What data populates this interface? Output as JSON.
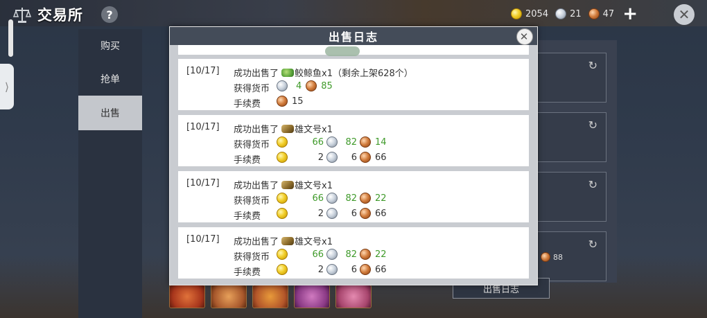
{
  "header": {
    "title": "交易所",
    "help_label": "?",
    "currencies": [
      {
        "type": "gold",
        "value": "2054"
      },
      {
        "type": "silver",
        "value": "21"
      },
      {
        "type": "copper",
        "value": "47"
      }
    ],
    "add_label": "+",
    "close_label": "✕"
  },
  "side_tabs": [
    {
      "label": "购买",
      "active": false
    },
    {
      "label": "抢单",
      "active": false
    },
    {
      "label": "出售",
      "active": true
    }
  ],
  "background_panel": {
    "price_peek": "88",
    "log_button": "出售日志"
  },
  "modal": {
    "title": "出售日志",
    "close_label": "✕",
    "entries": [
      {
        "date": "[10/17]",
        "sold_prefix": "成功出售了",
        "item_icon": "fish-icon",
        "item_text": "鲛鲸鱼x1（剩余上架628个）",
        "earned_label": "获得货币",
        "earned": {
          "silver": "4",
          "copper": "85"
        },
        "fee_label": "手续费",
        "fee": {
          "copper": "15"
        }
      },
      {
        "date": "[10/17]",
        "sold_prefix": "成功出售了",
        "item_icon": "banner-icon",
        "item_text": "雄文号x1",
        "earned_label": "获得货币",
        "earned": {
          "gold": "66",
          "silver": "82",
          "copper": "14"
        },
        "fee_label": "手续费",
        "fee": {
          "gold": "2",
          "silver": "6",
          "copper": "66"
        }
      },
      {
        "date": "[10/17]",
        "sold_prefix": "成功出售了",
        "item_icon": "banner-icon",
        "item_text": "雄文号x1",
        "earned_label": "获得货币",
        "earned": {
          "gold": "66",
          "silver": "82",
          "copper": "22"
        },
        "fee_label": "手续费",
        "fee": {
          "gold": "2",
          "silver": "6",
          "copper": "66"
        }
      },
      {
        "date": "[10/17]",
        "sold_prefix": "成功出售了",
        "item_icon": "banner-icon",
        "item_text": "雄文号x1",
        "earned_label": "获得货币",
        "earned": {
          "gold": "66",
          "silver": "82",
          "copper": "22"
        },
        "fee_label": "手续费",
        "fee": {
          "gold": "2",
          "silver": "6",
          "copper": "66"
        }
      }
    ]
  },
  "colors": {
    "earned_value": "#3f9a2a",
    "modal_header": "#444c59",
    "modal_body": "#c9ccd1"
  }
}
